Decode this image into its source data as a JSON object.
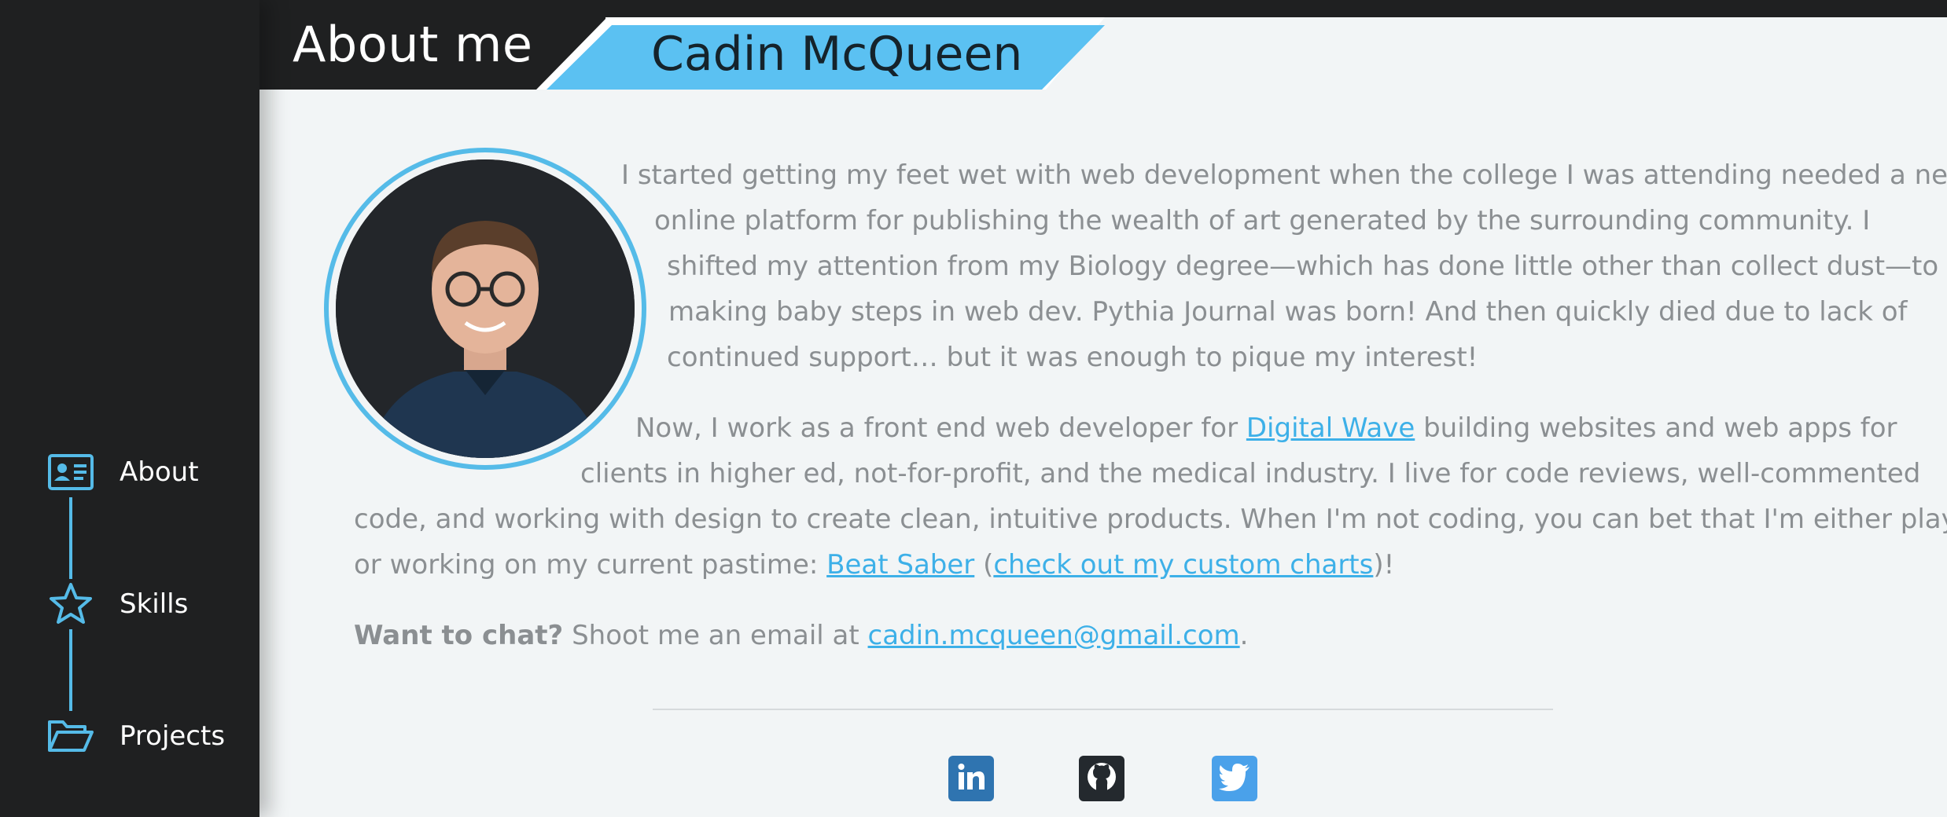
{
  "header": {
    "title": "About me",
    "name": "Cadin McQueen"
  },
  "sidebar": {
    "items": [
      {
        "label": "About",
        "icon": "id-card-icon"
      },
      {
        "label": "Skills",
        "icon": "star-icon"
      },
      {
        "label": "Projects",
        "icon": "folder-open-icon"
      }
    ]
  },
  "about": {
    "p1": [
      "I started getting my feet wet with web development when the college I was attending needed a new",
      "online platform for publishing the wealth of art generated by the surrounding community. I",
      "shifted my attention from my Biology degree—which has done little other than collect dust—to",
      "making baby steps in web dev. Pythia Journal was born! And then quickly died due to lack of",
      "continued support… but it was enough to pique my interest!"
    ],
    "p2": {
      "l1_pre": "Now, I work as a front end web developer for ",
      "l1_link": "Digital Wave",
      "l1_post": " building websites and web apps for",
      "l2": "clients in higher ed, not-for-profit, and the medical industry. I live for code reviews, well-commented",
      "l3": "code, and working with design to create clean, intuitive products. When I'm not coding, you can bet that I'm either playing",
      "l4_pre": "or working on my current pastime: ",
      "l4_link1": "Beat Saber",
      "l4_mid": " (",
      "l4_link2": "check out my custom charts",
      "l4_post": ")!"
    },
    "p3": {
      "bold": "Want to chat?",
      "text": " Shoot me an email at ",
      "email": "cadin.mcqueen@gmail.com",
      "end": "."
    }
  },
  "social": [
    {
      "icon": "linkedin-icon",
      "color": "#2f74b0"
    },
    {
      "icon": "github-icon",
      "color": "#24292e"
    },
    {
      "icon": "twitter-icon",
      "color": "#4aa1ea"
    }
  ],
  "colors": {
    "accent": "#55bbe8",
    "dark": "#1f2021",
    "background": "#f2f5f6",
    "text": "#8b8f92",
    "link": "#3db0e8"
  }
}
